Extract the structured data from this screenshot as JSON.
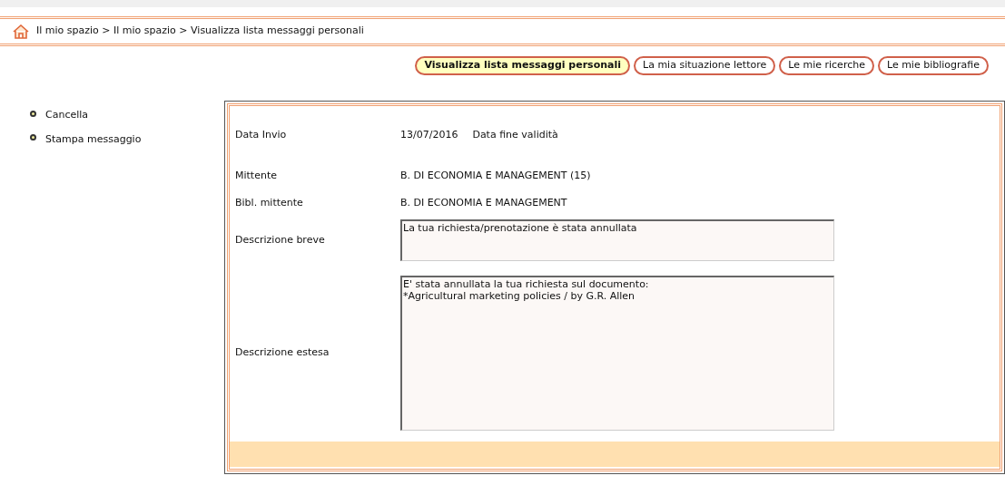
{
  "breadcrumb": "Il mio spazio > Il mio spazio > Visualizza lista messaggi personali",
  "tabs": [
    {
      "label": "Visualizza lista messaggi personali",
      "selected": true
    },
    {
      "label": "La mia situazione lettore",
      "selected": false
    },
    {
      "label": "Le mie ricerche",
      "selected": false
    },
    {
      "label": "Le mie bibliografie",
      "selected": false
    }
  ],
  "menu": [
    "Cancella",
    "Stampa messaggio"
  ],
  "fields": [
    {
      "kind": "text",
      "label": "Data Invio",
      "value": "13/07/2016",
      "extra": "Data fine validità"
    },
    {
      "kind": "text",
      "label": "Mittente",
      "value": "B. DI ECONOMIA E MANAGEMENT (15)"
    },
    {
      "kind": "text",
      "label": "Bibl. mittente",
      "value": "B. DI ECONOMIA E MANAGEMENT"
    },
    {
      "kind": "area",
      "label": "Descrizione breve",
      "value": "La tua richiesta/prenotazione è stata annullata"
    },
    {
      "kind": "area_large",
      "label": "Descrizione estesa",
      "value": "E' stata annullata la tua richiesta sul documento:\n*Agricultural marketing policies / by G.R. Allen"
    }
  ]
}
